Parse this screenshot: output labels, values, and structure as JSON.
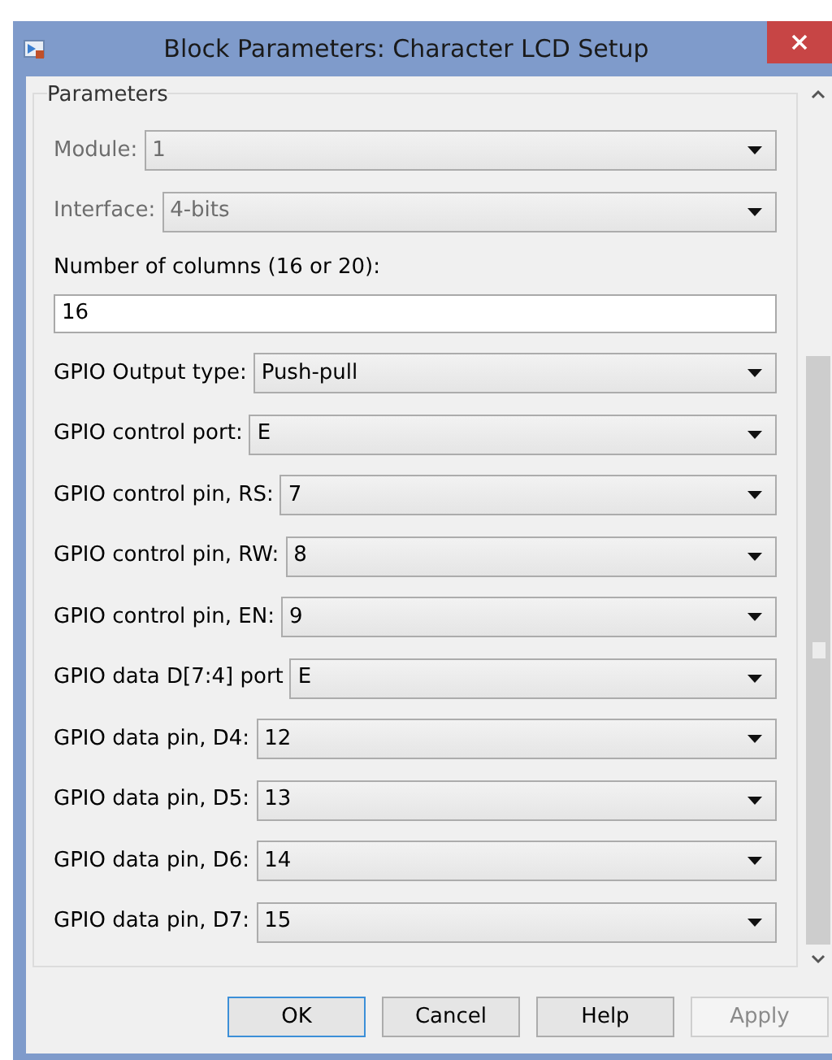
{
  "window": {
    "title": "Block Parameters: Character LCD Setup"
  },
  "group": {
    "title": "Parameters"
  },
  "parameters": [
    {
      "kind": "popup",
      "label": "Module:",
      "value": "1",
      "disabled": true
    },
    {
      "kind": "popup",
      "label": "Interface:",
      "value": "4-bits",
      "disabled": true
    },
    {
      "kind": "edit",
      "label": "Number of columns (16 or 20):",
      "value": "16",
      "disabled": false
    },
    {
      "kind": "popup",
      "label": "GPIO Output type:",
      "value": "Push-pull",
      "disabled": false
    },
    {
      "kind": "popup",
      "label": "GPIO control port:",
      "value": "E",
      "disabled": false
    },
    {
      "kind": "popup",
      "label": "GPIO control pin, RS:",
      "value": "7",
      "disabled": false
    },
    {
      "kind": "popup",
      "label": "GPIO control pin, RW:",
      "value": "8",
      "disabled": false
    },
    {
      "kind": "popup",
      "label": "GPIO control pin, EN:",
      "value": "9",
      "disabled": false
    },
    {
      "kind": "popup",
      "label": "GPIO data D[7:4] port",
      "value": "E",
      "disabled": false
    },
    {
      "kind": "popup",
      "label": "GPIO data pin, D4:",
      "value": "12",
      "disabled": false
    },
    {
      "kind": "popup",
      "label": "GPIO data pin, D5:",
      "value": "13",
      "disabled": false
    },
    {
      "kind": "popup",
      "label": "GPIO data pin, D6:",
      "value": "14",
      "disabled": false
    },
    {
      "kind": "popup",
      "label": "GPIO data pin, D7:",
      "value": "15",
      "disabled": false
    }
  ],
  "buttons": [
    {
      "label": "OK",
      "focused": true,
      "disabled": false
    },
    {
      "label": "Cancel",
      "focused": false,
      "disabled": false
    },
    {
      "label": "Help",
      "focused": false,
      "disabled": false
    },
    {
      "label": "Apply",
      "focused": false,
      "disabled": true
    }
  ]
}
